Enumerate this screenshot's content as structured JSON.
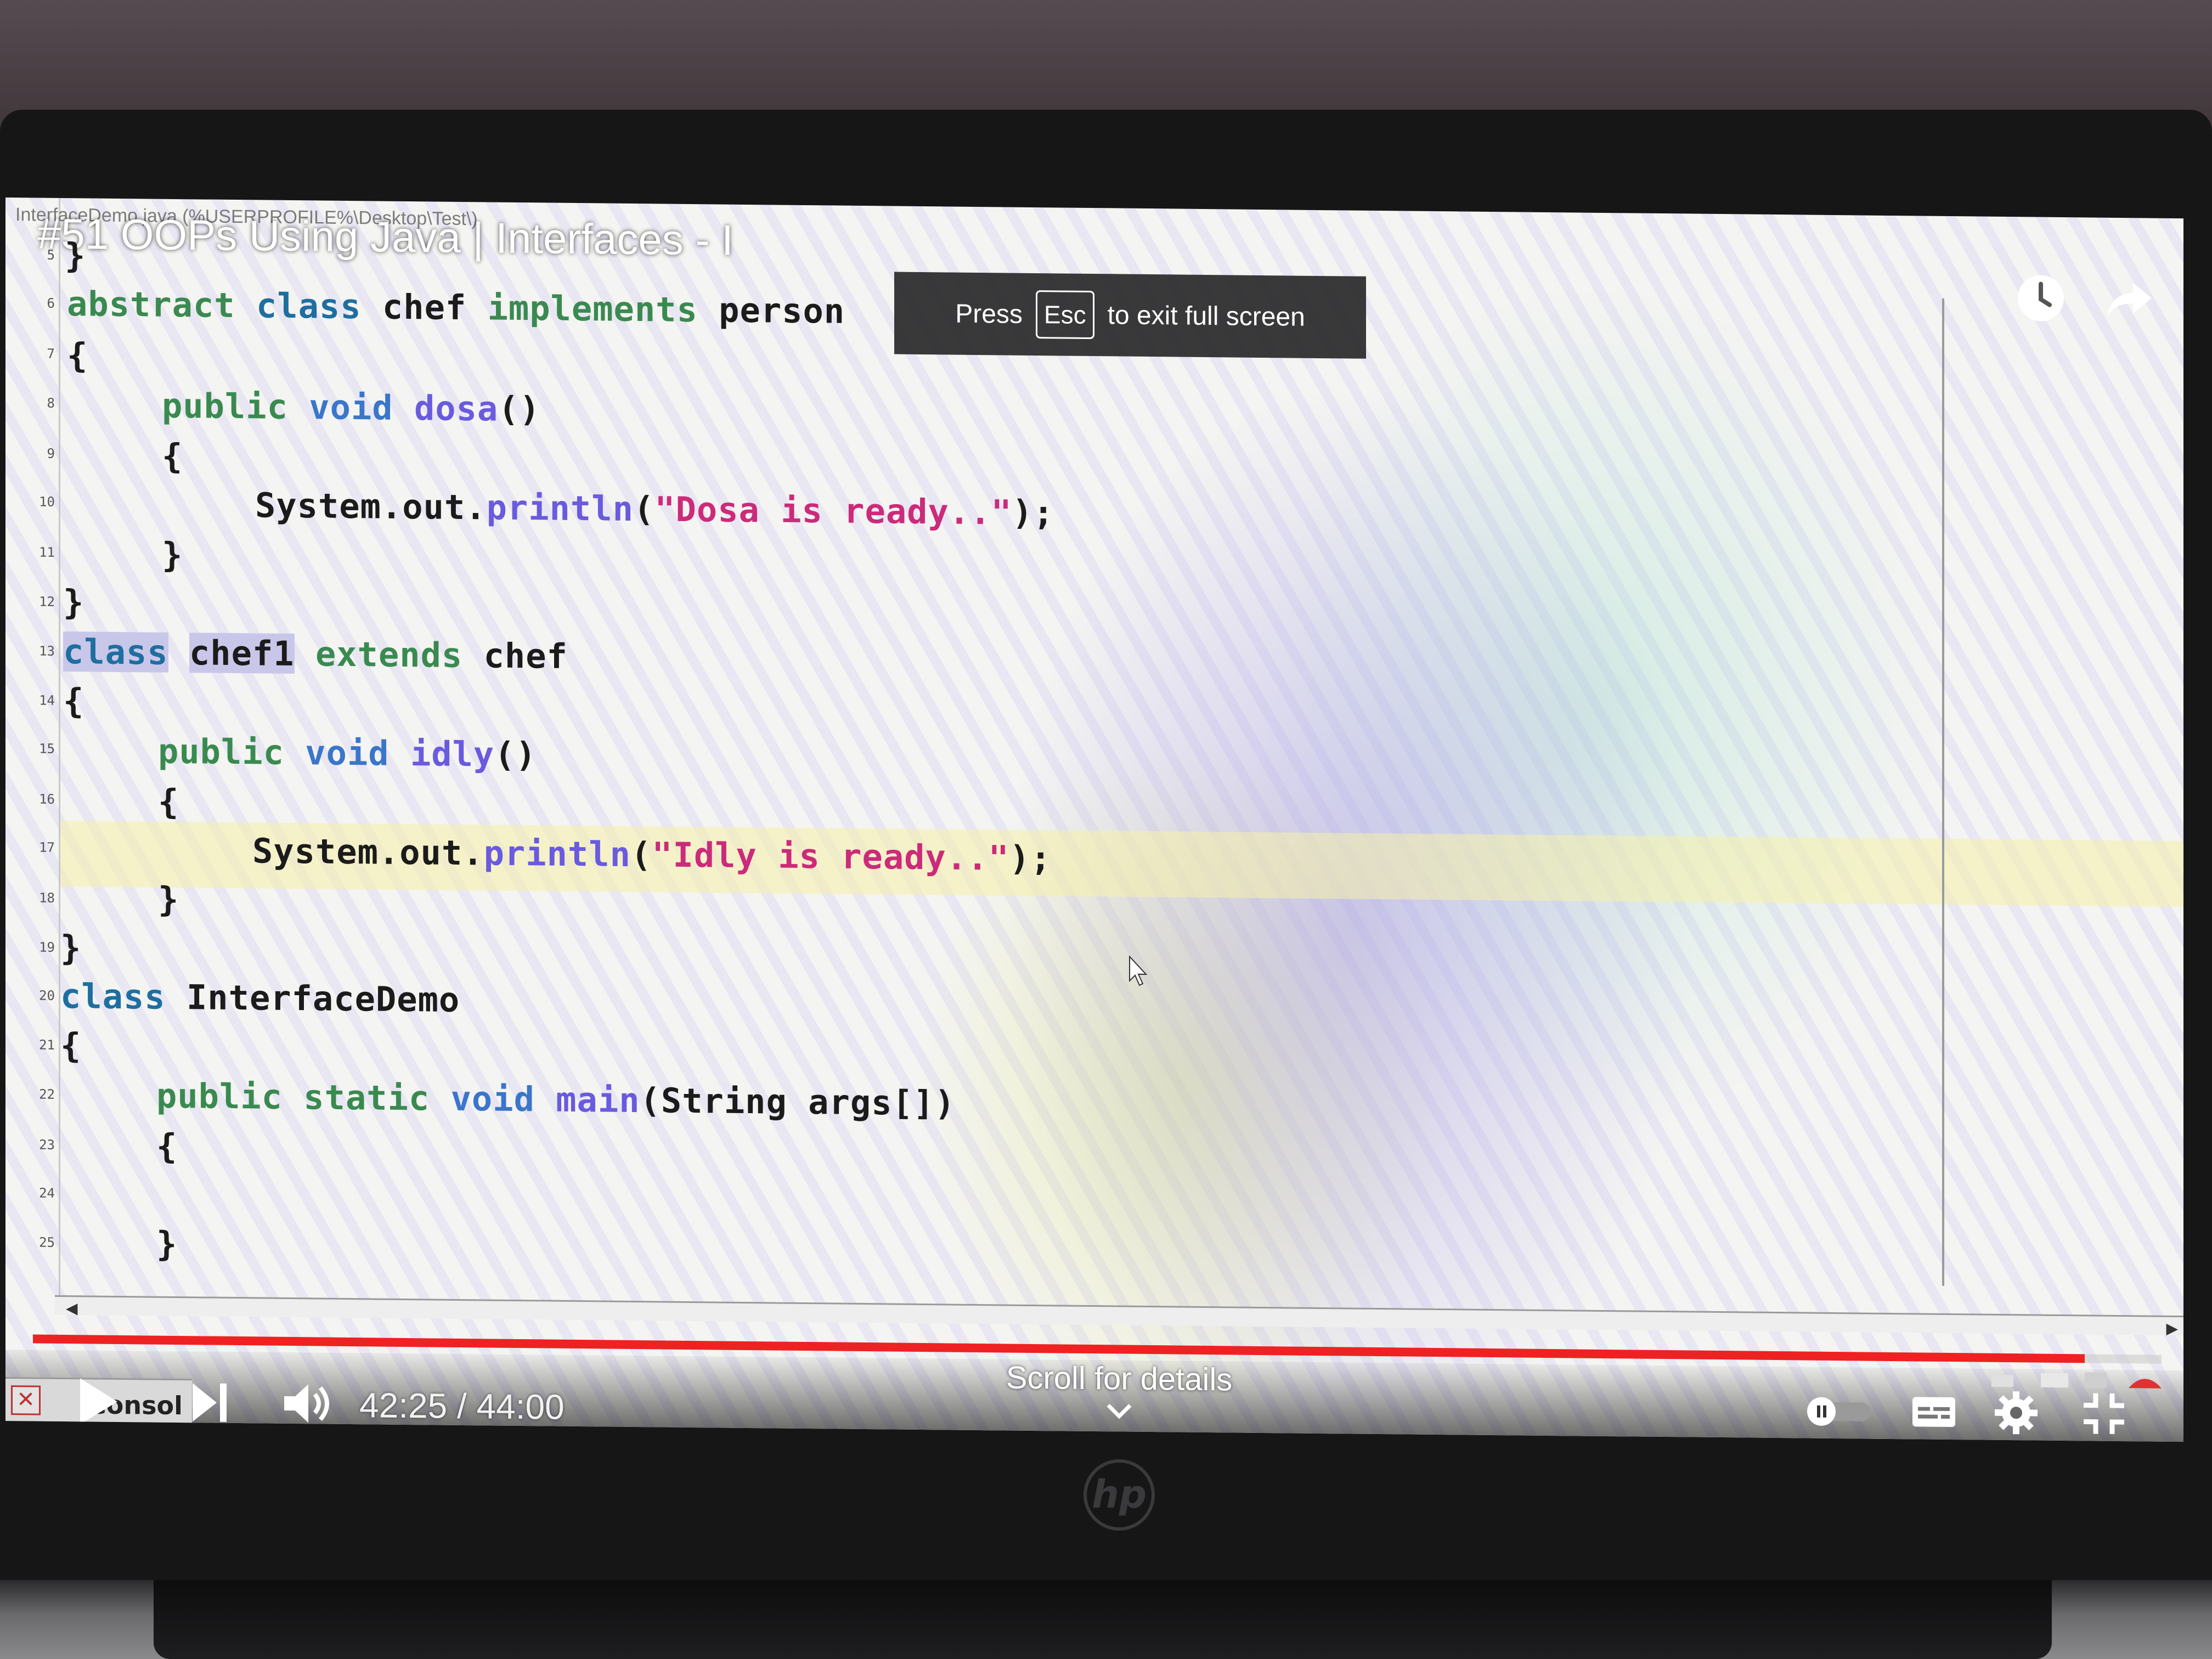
{
  "editor": {
    "file_path": "InterfaceDemo.java (%USERPROFILE%\\Desktop\\Test\\)",
    "line_numbers": [
      "5",
      "6",
      "7",
      "8",
      "9",
      "10",
      "11",
      "12",
      "13",
      "14",
      "15",
      "16",
      "17",
      "18",
      "19",
      "20",
      "21",
      "22",
      "23",
      "24",
      "25"
    ]
  },
  "code": {
    "l5": "}",
    "l6": {
      "kw1": "abstract",
      "kw2": "class",
      "name": "chef",
      "kw3": "implements",
      "iface": "person"
    },
    "l7": "{",
    "l8": {
      "kw1": "public",
      "kw2": "void",
      "method": "dosa",
      "rest": "()"
    },
    "l9": "{",
    "l10": {
      "obj": "System.out.",
      "method": "println",
      "open": "(",
      "str": "\"Dosa is ready..\"",
      "close": ");"
    },
    "l11": "}",
    "l12": "}",
    "l13": {
      "kw1": "class",
      "name": "chef1",
      "kw2": "extends",
      "parent": "chef"
    },
    "l14": "{",
    "l15": {
      "kw1": "public",
      "kw2": "void",
      "method": "idly",
      "rest": "()"
    },
    "l16": "{",
    "l17": {
      "obj": "System.out.",
      "method": "println",
      "open": "(",
      "str": "\"Idly is ready..\"",
      "close": ");"
    },
    "l18": "}",
    "l19": "}",
    "l20": {
      "kw1": "class",
      "name": "InterfaceDemo"
    },
    "l21": "{",
    "l22": {
      "kw1": "public",
      "kw2": "static",
      "kw3": "void",
      "method": "main",
      "rest": "(String args[])"
    },
    "l23": "{",
    "l25": "}"
  },
  "video": {
    "title": "#51 OOPs Using Java | Interfaces - I",
    "time": "42:25 / 44:00",
    "progress": 0.964,
    "scroll_hint": "Scroll for details"
  },
  "toast": {
    "press": "Press",
    "key": "Esc",
    "message": "to exit full screen"
  },
  "console": {
    "label": "Consol"
  },
  "colors": {
    "keyword": "#1e6fa0",
    "keyword_green": "#3a8a50",
    "string": "#cc2a7a",
    "method": "#6a5adf",
    "progress": "#ee2222"
  },
  "icons": [
    "clock-icon",
    "share-icon",
    "play-icon",
    "next-icon",
    "volume-icon",
    "autoplay-toggle-icon",
    "captions-icon",
    "gear-icon",
    "exit-fullscreen-icon",
    "chevron-down-icon"
  ]
}
